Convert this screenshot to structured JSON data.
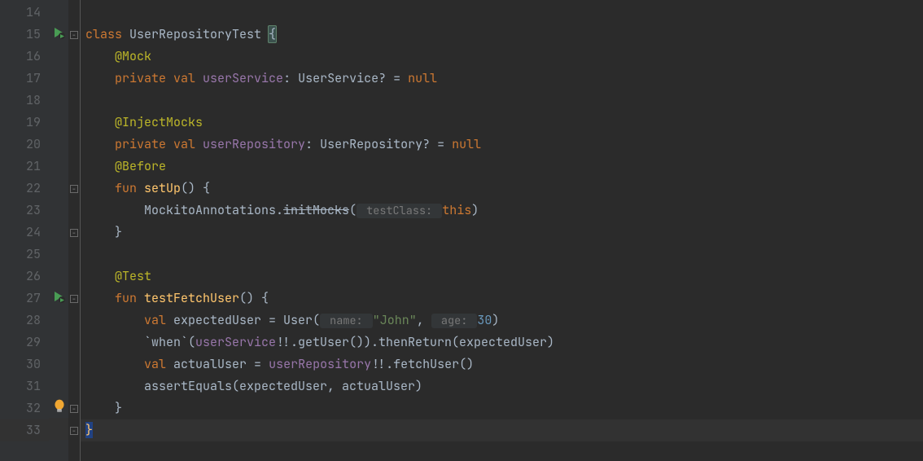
{
  "lineNumbers": [
    "14",
    "15",
    "16",
    "17",
    "18",
    "19",
    "20",
    "21",
    "22",
    "23",
    "24",
    "25",
    "26",
    "27",
    "28",
    "29",
    "30",
    "31",
    "32",
    "33"
  ],
  "tokens": {
    "class": "class ",
    "className": "UserRepositoryTest ",
    "openBrace": "{",
    "annMock": "@Mock",
    "private": "private ",
    "val": "val ",
    "userService": "userService",
    "colonUserService": ": UserService? = ",
    "nullKw": "null",
    "annInject": "@InjectMocks",
    "userRepository": "userRepository",
    "colonUserRepo": ": UserRepository? = ",
    "annBefore": "@Before",
    "funKw": "fun ",
    "setUp": "setUp",
    "setUpParen": "() {",
    "mockitoCall1": "MockitoAnnotations.",
    "initMocks": "initMocks",
    "openParen": "(",
    "hintTestClass": " testClass: ",
    "thisKw": "this",
    "closeParen": ")",
    "closeBrace": "}",
    "annTest": "@Test",
    "testFetchUser": "testFetchUser",
    "testParen": "() {",
    "expectedUser": "expectedUser",
    "eqUser": " = User(",
    "hintName": " name: ",
    "john": "\"John\"",
    "comma": ", ",
    "hintAge": " age: ",
    "num30": "30",
    "whenTick": "`when`(",
    "bangGetUser": "!!.getUser()).thenReturn(expectedUser)",
    "actualUser": "actualUser",
    "eq": " = ",
    "bangFetch": "!!.fetchUser()",
    "assertEquals": "assertEquals(expectedUser, actualUser)"
  },
  "indent": {
    "i1": "    ",
    "i2": "        ",
    "i3": "            "
  }
}
